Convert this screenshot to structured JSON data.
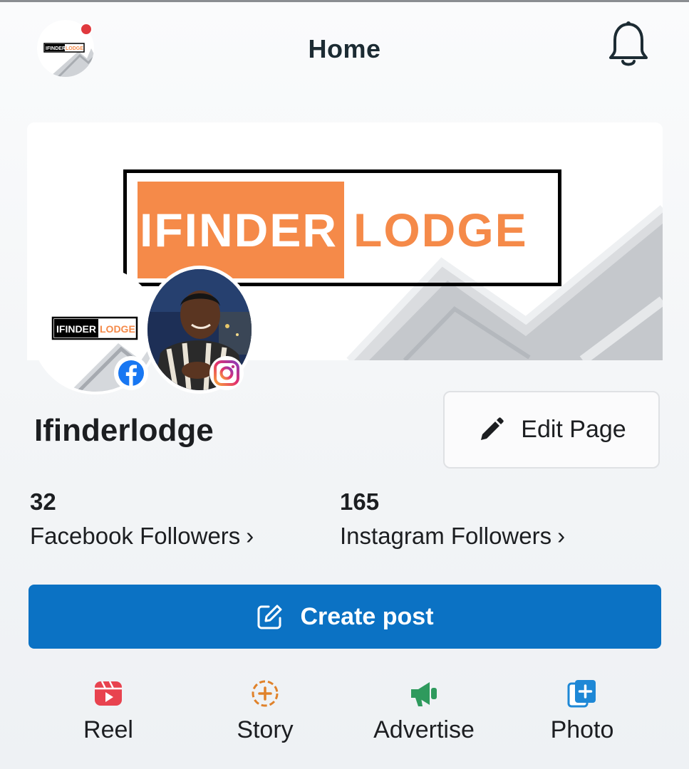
{
  "header": {
    "title": "Home",
    "avatar_icon": "page-logo-avatar",
    "notification_icon": "bell-icon",
    "notif_color": "#e0393e"
  },
  "cover": {
    "logo_part_a": "IFINDER",
    "logo_part_b": "LODGE",
    "brand_color": "#f58a49"
  },
  "avatar": {
    "logo_part_a": "IFINDER",
    "logo_part_b": "LODGE"
  },
  "profile": {
    "name": "Ifinderlodge",
    "edit_label": "Edit Page"
  },
  "stats": [
    {
      "count": "32",
      "label": "Facebook Followers"
    },
    {
      "count": "165",
      "label": "Instagram Followers"
    }
  ],
  "create_post": {
    "label": "Create post",
    "color": "#0b72c4"
  },
  "actions": [
    {
      "label": "Reel",
      "icon": "reel-icon",
      "color": "#e8434f"
    },
    {
      "label": "Story",
      "icon": "story-icon",
      "color": "#e0822a"
    },
    {
      "label": "Advertise",
      "icon": "megaphone-icon",
      "color": "#2e9a5d"
    },
    {
      "label": "Photo",
      "icon": "photo-add-icon",
      "color": "#1e88d6"
    }
  ]
}
